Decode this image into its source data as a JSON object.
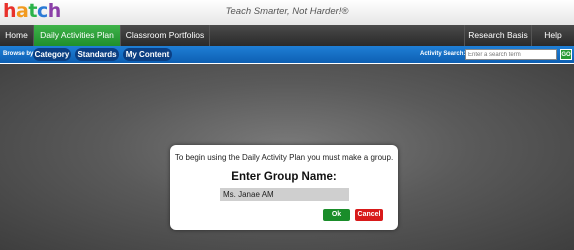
{
  "header": {
    "logo_text": "hatch",
    "logo_colors": [
      "#e8312b",
      "#f29a1f",
      "#2bb34a",
      "#2b7bd6",
      "#8b3fa8"
    ],
    "tagline": "Teach Smarter, Not Harder!®"
  },
  "nav": {
    "items": [
      {
        "label": "Home"
      },
      {
        "label": "Daily Activities Plan",
        "active": true
      },
      {
        "label": "Classroom Portfolios"
      },
      {
        "label": "Research Basis"
      },
      {
        "label": "Help"
      }
    ]
  },
  "browse": {
    "label": "Browse by:",
    "pills": [
      "Category",
      "Standards",
      "My Content"
    ],
    "search_label": "Activity Search:",
    "search_placeholder": "Enter a search term",
    "go_label": "GO"
  },
  "dialog": {
    "message": "To begin using the Daily Activity Plan you must make a group.",
    "title": "Enter Group Name:",
    "input_value": "Ms. Janae AM",
    "ok_label": "Ok",
    "cancel_label": "Cancel"
  },
  "colors": {
    "active_tab": "#2aa03a",
    "browse_bar": "#1470c8",
    "ok": "#1a8d2a",
    "cancel": "#d81a1a"
  }
}
